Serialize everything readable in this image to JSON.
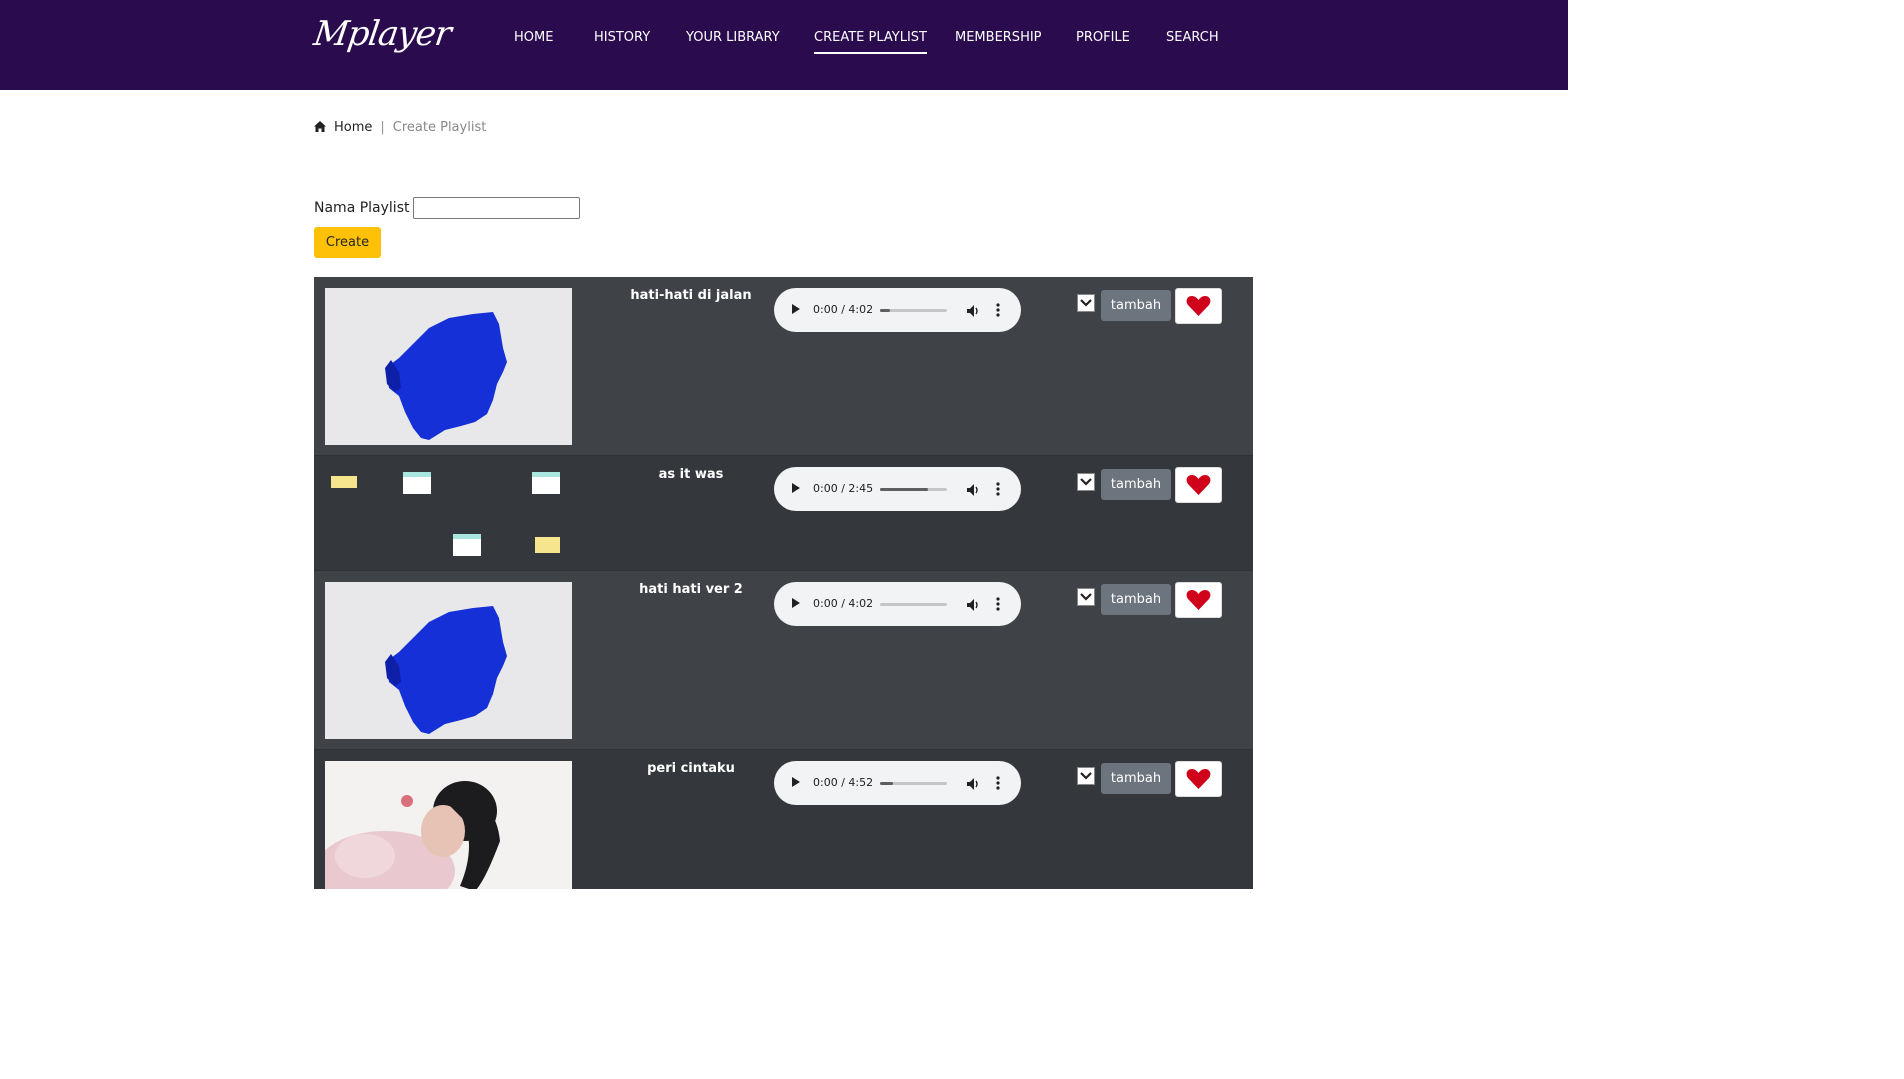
{
  "brand": {
    "logo": "Mplayer"
  },
  "nav": {
    "items": [
      {
        "label": "HOME"
      },
      {
        "label": "HISTORY"
      },
      {
        "label": "YOUR LIBRARY"
      },
      {
        "label": "CREATE PLAYLIST",
        "active": true
      },
      {
        "label": "MEMBERSHIP"
      },
      {
        "label": "PROFILE"
      },
      {
        "label": "SEARCH"
      }
    ]
  },
  "breadcrumb": {
    "home": "Home",
    "separator": "|",
    "current": "Create Playlist"
  },
  "form": {
    "label": "Nama Playlist :",
    "value": "",
    "button": "Create"
  },
  "songs": [
    {
      "title": "hati-hati di jalan",
      "time": "0:00 / 4:02",
      "progress": 0.15,
      "add": "tambah",
      "thumb": "blue-face"
    },
    {
      "title": "as it was",
      "time": "0:00 / 2:45",
      "progress": 0.72,
      "add": "tambah",
      "thumb": "diagram"
    },
    {
      "title": "hati hati ver 2",
      "time": "0:00 / 4:02",
      "progress": 0.0,
      "add": "tambah",
      "thumb": "blue-face"
    },
    {
      "title": "peri cintaku",
      "time": "0:00 / 4:52",
      "progress": 0.2,
      "add": "tambah",
      "thumb": "portrait"
    }
  ],
  "colors": {
    "header": "#2a0c4e",
    "create_button": "#ffc107",
    "table": "#3a3d42",
    "tambah": "#6c757d",
    "heart": "#d0021b"
  },
  "icons": [
    "home-icon",
    "play-icon",
    "volume-icon",
    "more-vert-icon",
    "chevron-down-icon",
    "heart-icon"
  ]
}
